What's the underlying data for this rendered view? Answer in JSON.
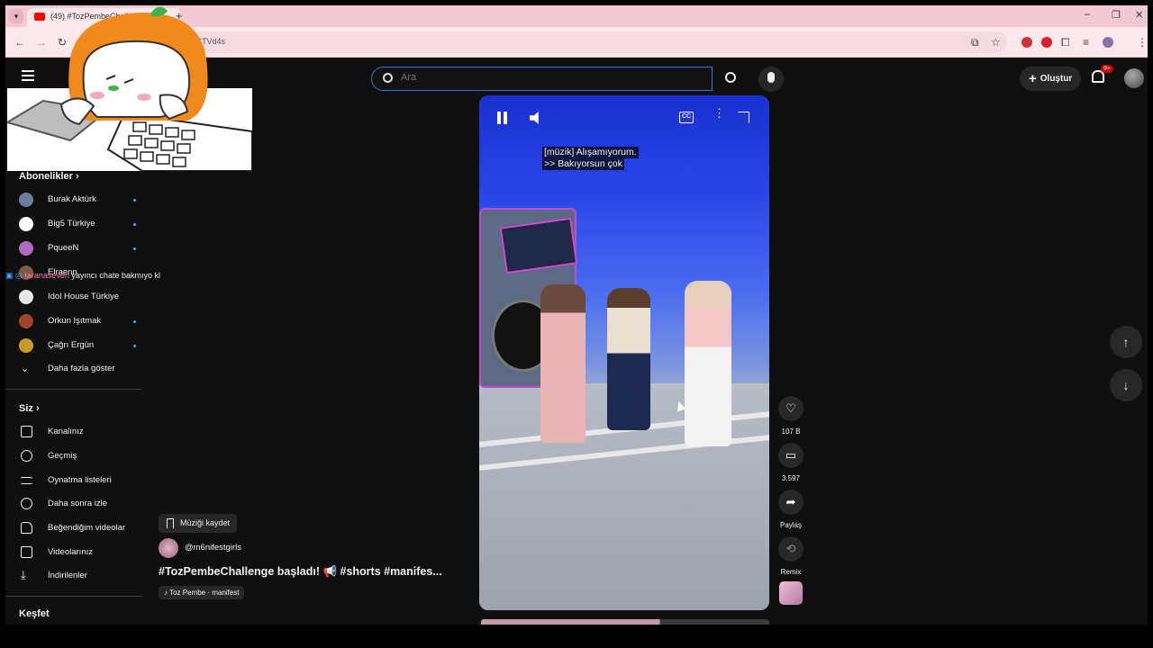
{
  "browser": {
    "tab_title": "(49) #TozPembeChallen",
    "url_fragment": "STVd4s",
    "new_tab_glyph": "+",
    "minimize": "–",
    "maximize": "❐",
    "close": "✕"
  },
  "header": {
    "search_placeholder": "Ara",
    "create_label": "Oluştur",
    "notification_count": "9+"
  },
  "sidebar": {
    "subscriptions_heading": "Abonelikler",
    "subscriptions": [
      {
        "label": "Burak Aktürk",
        "color": "#6d7f9c",
        "new": true
      },
      {
        "label": "Big5 Türkiye",
        "color": "#ffffff",
        "new": true
      },
      {
        "label": "PqueeN",
        "color": "#b06ac0",
        "new": true
      },
      {
        "label": "Elraenn",
        "color": "#7b5a48",
        "new": false
      },
      {
        "label": "Idol House Türkiye",
        "color": "#e8e8e8",
        "new": false
      },
      {
        "label": "Orkun Işıtmak",
        "color": "#a0432e",
        "new": true
      },
      {
        "label": "Çağrı Ergün",
        "color": "#c79a2e",
        "new": true
      }
    ],
    "show_more_label": "Daha fazla göster",
    "you_heading": "Siz",
    "you_items": [
      {
        "label": "Kanalınız",
        "icon": "channel-icon"
      },
      {
        "label": "Geçmiş",
        "icon": "history-icon"
      },
      {
        "label": "Oynatma listeleri",
        "icon": "playlists-icon"
      },
      {
        "label": "Daha sonra izle",
        "icon": "watch-later-icon"
      },
      {
        "label": "Beğendiğim videolar",
        "icon": "like-icon"
      },
      {
        "label": "Videolarınız",
        "icon": "your-videos-icon"
      },
      {
        "label": "İndirilenler",
        "icon": "downloads-icon"
      }
    ],
    "explore_heading": "Keşfet"
  },
  "chat_overlay": {
    "user": "taranaseven",
    "message": "yayıncı chate bakmıyo kl"
  },
  "player": {
    "caption_line1": "[müzik] Alışamıyorum.",
    "caption_line2": ">> Bakıyorsun çok",
    "cc_label": "CC"
  },
  "actions": {
    "like_count": "107 B",
    "comment_count": "3.597",
    "share_label": "Paylaş",
    "remix_label": "Remix"
  },
  "video": {
    "save_music_label": "Müziği kaydet",
    "channel": "@m6nifestgirls",
    "title": "#TozPembeChallenge başladı! 📢 #shorts #manifes...",
    "music": "♪ Toz Pembe · manifest"
  },
  "colors": {
    "accent_blue": "#3ea6ff",
    "youtube_red": "#ff0000",
    "browser_pink": "#f2c9d4"
  }
}
